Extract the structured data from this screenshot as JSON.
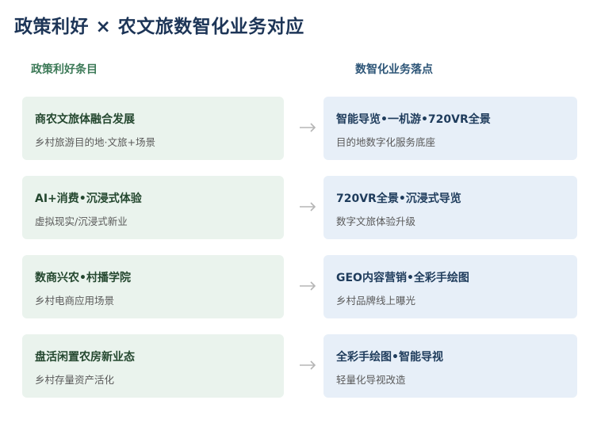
{
  "title": "政策利好 × 农文旅数智化业务对应",
  "headers": {
    "left": "政策利好条目",
    "right": "数智化业务落点"
  },
  "rows": [
    {
      "policy_title": "商农文旅体融合发展",
      "policy_sub": "乡村旅游目的地·文旅+场景",
      "business_title": "智能导览•一机游•720VR全景",
      "business_sub": "目的地数字化服务底座"
    },
    {
      "policy_title": "AI+消费•沉浸式体验",
      "policy_sub": "虚拟现实/沉浸式新业",
      "business_title": "720VR全景•沉浸式导览",
      "business_sub": "数字文旅体验升级"
    },
    {
      "policy_title": "数商兴农•村播学院",
      "policy_sub": "乡村电商应用场景",
      "business_title": "GEO内容营销•全彩手绘图",
      "business_sub": "乡村品牌线上曝光"
    },
    {
      "policy_title": "盘活闲置农房新业态",
      "policy_sub": "乡村存量资产活化",
      "business_title": "全彩手绘图•智能导视",
      "business_sub": "轻量化导视改造"
    }
  ],
  "arrow_icon": "right-arrow-icon",
  "colors": {
    "title": "#1d3557",
    "left_card_bg": "#eaf3ed",
    "right_card_bg": "#e7eff8",
    "left_header": "#3d7a58",
    "right_header": "#2e5678",
    "arrow": "#b5b5b5"
  }
}
